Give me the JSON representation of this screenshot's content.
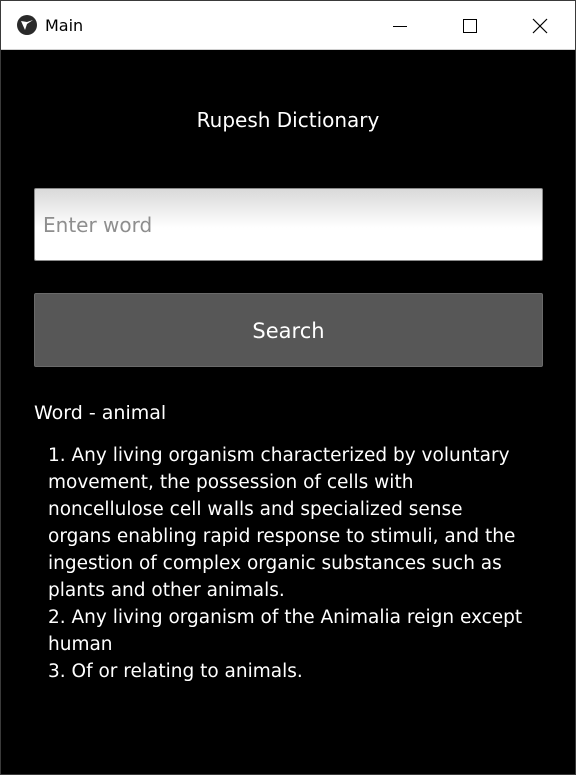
{
  "window": {
    "title": "Main",
    "icon": "kivy-logo-icon",
    "controls": [
      "minimize-icon",
      "maximize-icon",
      "close-icon"
    ]
  },
  "app": {
    "heading": "Rupesh Dictionary",
    "input": {
      "placeholder": "Enter word",
      "value": ""
    },
    "search_label": "Search",
    "word_label": "Word - animal",
    "definitions": "1. Any living organism characterized by voluntary movement, the possession of cells with noncellulose cell walls and specialized sense organs enabling rapid response to stimuli, and the ingestion of complex organic substances such as plants and other animals.\n2. Any living organism of the Animalia reign except human\n3. Of or relating to animals."
  },
  "colors": {
    "background": "#000000",
    "button": "#575757",
    "text": "#ffffff"
  }
}
